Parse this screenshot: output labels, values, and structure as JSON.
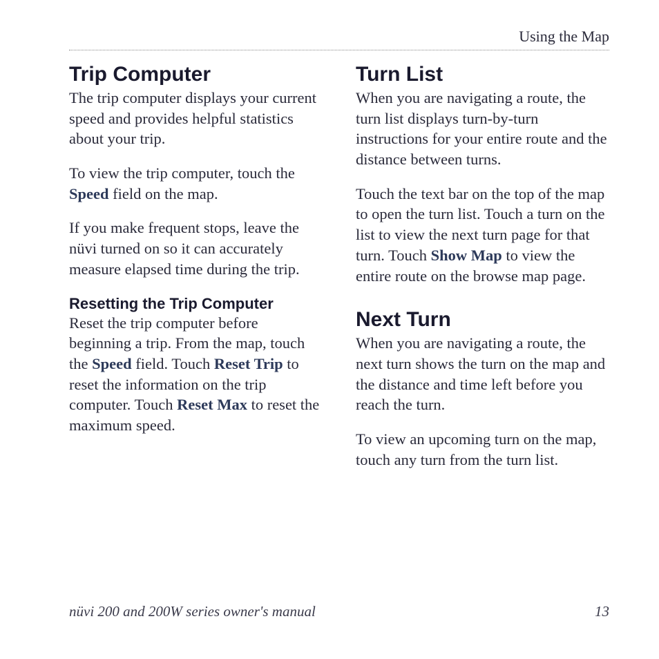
{
  "header": {
    "section": "Using the Map"
  },
  "left": {
    "h2_trip": "Trip Computer",
    "p1a": "The trip computer displays your current speed and provides helpful statistics about your trip.",
    "p2_pre": "To view the trip computer, touch the ",
    "p2_kw": "Speed",
    "p2_post": " field on the map.",
    "p3": "If you make frequent stops, leave the nüvi turned on so it can accurately measure elapsed time during the trip.",
    "h3_reset": "Resetting the Trip Computer",
    "p4_a": "Reset the trip computer before beginning a trip. From the map, touch the ",
    "p4_kw1": "Speed",
    "p4_b": " field. Touch ",
    "p4_kw2": "Reset Trip",
    "p4_c": " to reset the information on the trip computer. Touch ",
    "p4_kw3": "Reset Max",
    "p4_d": " to reset the maximum speed."
  },
  "right": {
    "h2_turnlist": "Turn List",
    "p1": "When you are navigating a route, the turn list displays turn-by-turn instructions for your entire route and the distance between turns.",
    "p2_a": "Touch the text bar on the top of the map to open the turn list. Touch a turn on the list to view the next turn page for that turn. Touch ",
    "p2_kw": "Show Map",
    "p2_b": " to view the entire route on the browse map page.",
    "h2_nextturn": "Next Turn",
    "p3": "When you are navigating a route, the next turn shows the turn on the map and the distance and time left before you reach the turn.",
    "p4": "To view an upcoming turn on the map, touch any turn from the turn list."
  },
  "footer": {
    "title": "nüvi 200 and 200W series owner's manual",
    "page": "13"
  }
}
